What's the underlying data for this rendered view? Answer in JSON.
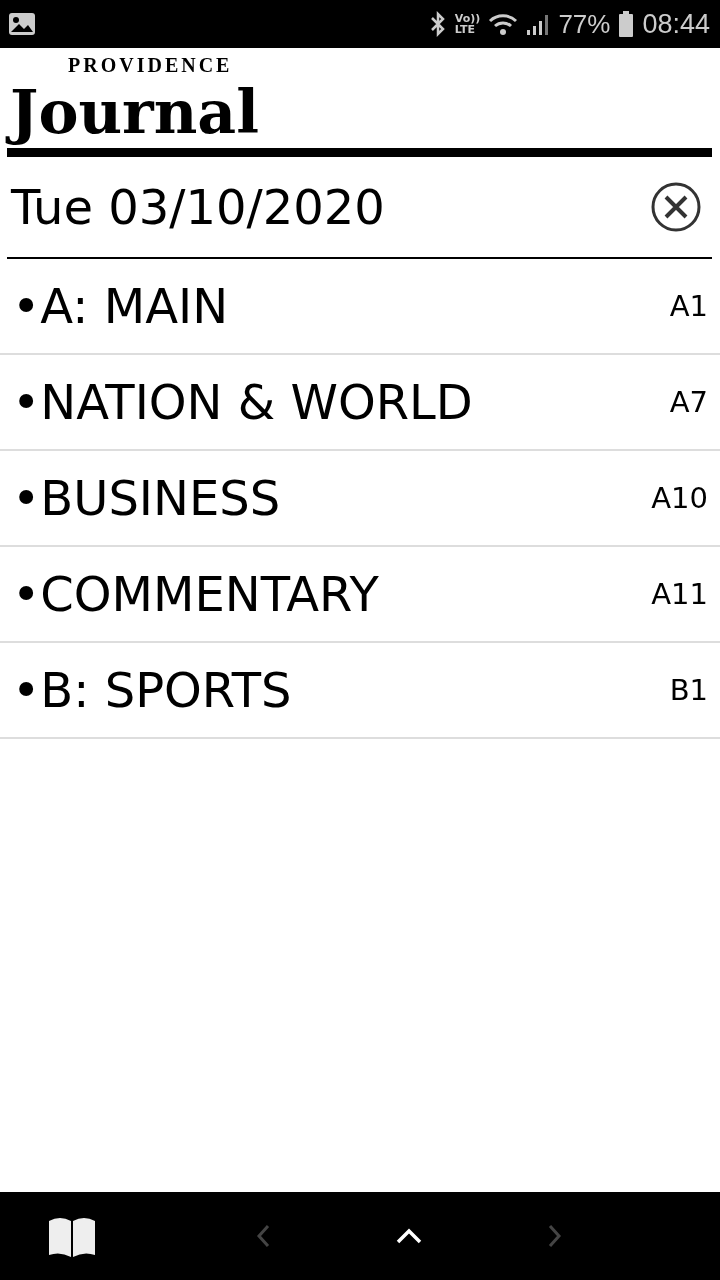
{
  "status_bar": {
    "volte_top": "Vo))",
    "volte_bottom": "LTE",
    "battery": "77%",
    "time": "08:44"
  },
  "masthead": {
    "overline": "PROVIDENCE",
    "title": "Journal"
  },
  "date": {
    "value": "Tue 03/10/2020"
  },
  "sections": [
    {
      "label": "•A: MAIN",
      "page": "A1"
    },
    {
      "label": "•NATION & WORLD",
      "page": "A7"
    },
    {
      "label": "•BUSINESS",
      "page": "A10"
    },
    {
      "label": "•COMMENTARY",
      "page": "A11"
    },
    {
      "label": "•B: SPORTS",
      "page": "B1"
    }
  ],
  "bottom_bar": {
    "prev_disabled": true,
    "next_disabled": true
  }
}
